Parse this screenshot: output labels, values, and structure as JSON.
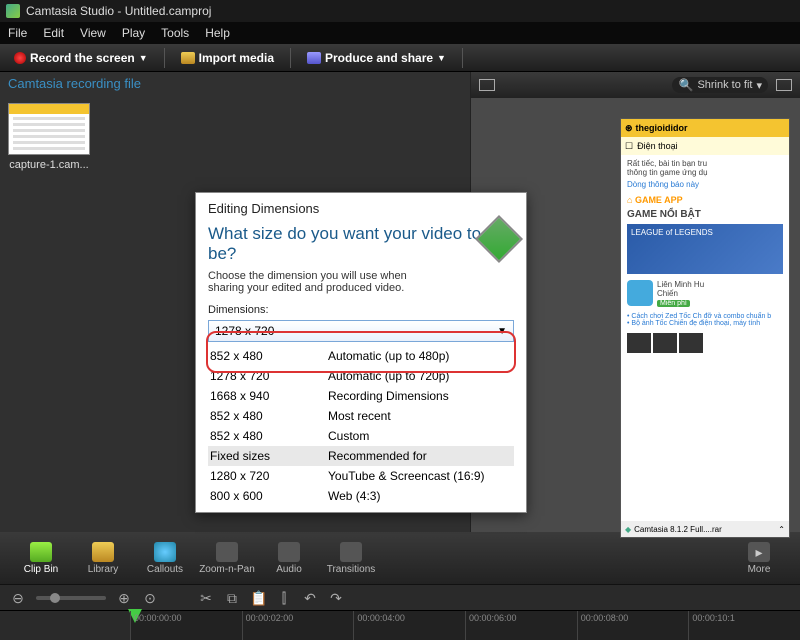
{
  "app": {
    "title": "Camtasia Studio - Untitled.camproj"
  },
  "menu": {
    "file": "File",
    "edit": "Edit",
    "view": "View",
    "play": "Play",
    "tools": "Tools",
    "help": "Help"
  },
  "toolbar": {
    "record": "Record the screen",
    "import": "Import media",
    "produce": "Produce and share"
  },
  "clipbin": {
    "header": "Camtasia recording file",
    "item_label": "capture-1.cam..."
  },
  "preview_ctl": {
    "shrink": "Shrink to fit"
  },
  "preview": {
    "brand": "thegioididor",
    "nav": "Điện thoại",
    "body_l1": "Rất tiếc, bài tin bạn tru",
    "body_l2": "thông tin game ứng dụ",
    "link": "Dòng thông báo này",
    "section": "GAME APP",
    "heading": "GAME NỔI BẬT",
    "card": "LEAGUE of LEGENDS",
    "app_name": "Liên Minh Hu",
    "app_sub": "Chiến",
    "app_badge": "Miễn phí",
    "b1": "Cách chơi Zed Tốc Ch đỡ và combo chuẩn b",
    "b2": "Bộ ảnh Tốc Chiến đẹ điện thoại, máy tính",
    "status": "Camtasia 8.1.2 Full....rar"
  },
  "dialog": {
    "title": "Editing Dimensions",
    "question": "What size do you want your video to be?",
    "sub": "Choose the dimension you will use when sharing your edited and produced video.",
    "label": "Dimensions:",
    "selected": "1278 x 720",
    "rows": [
      {
        "c1": "852 x 480",
        "c2": "Automatic (up to 480p)"
      },
      {
        "c1": "1278 x 720",
        "c2": "Automatic (up to 720p)"
      },
      {
        "c1": "1668 x 940",
        "c2": "Recording Dimensions"
      },
      {
        "c1": "852 x 480",
        "c2": "Most recent"
      },
      {
        "c1": "852 x 480",
        "c2": "Custom"
      },
      {
        "c1": "Fixed sizes",
        "c2": "Recommended for",
        "hl": true
      },
      {
        "c1": "1280 x 720",
        "c2": "YouTube & Screencast (16:9)"
      },
      {
        "c1": "800 x 600",
        "c2": "Web (4:3)"
      }
    ]
  },
  "tabs": {
    "clip": "Clip Bin",
    "library": "Library",
    "callouts": "Callouts",
    "zoom": "Zoom-n-Pan",
    "audio": "Audio",
    "transitions": "Transitions",
    "more": "More"
  },
  "timeline": {
    "ticks": [
      "00:00:00:00",
      "00:00:02:00",
      "00:00:04:00",
      "00:00:06:00",
      "00:00:08:00",
      "00:00:10:1"
    ]
  }
}
